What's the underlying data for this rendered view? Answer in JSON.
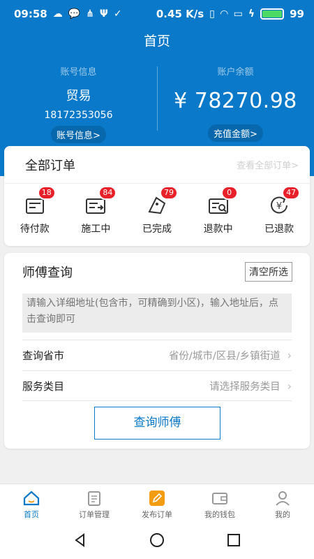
{
  "status_bar": {
    "time": "09:58",
    "speed": "0.45 K/s",
    "battery": "99",
    "battery_level": 0.99
  },
  "header": {
    "title": "首页"
  },
  "account": {
    "info_heading": "账号信息",
    "name": "贸易",
    "phone": "18172353056",
    "info_button": "账号信息>",
    "balance_heading": "账户余额",
    "balance": "¥ 78270.98",
    "recharge_button": "充值金额>"
  },
  "orders": {
    "title": "全部订单",
    "view_all": "查看全部订单>",
    "items": [
      {
        "label": "待付款",
        "count": "18",
        "icon": "pending-payment-icon"
      },
      {
        "label": "施工中",
        "count": "84",
        "icon": "in-construction-icon"
      },
      {
        "label": "已完成",
        "count": "79",
        "icon": "completed-icon"
      },
      {
        "label": "退款中",
        "count": "0",
        "icon": "refunding-icon"
      },
      {
        "label": "已退款",
        "count": "47",
        "icon": "refunded-icon"
      }
    ]
  },
  "master_search": {
    "title": "师傅查询",
    "clear_button": "清空所选",
    "address_placeholder": "请输入详细地址(包含市，可精确到小区)，输入地址后，点击查询即可",
    "region_label": "查询省市",
    "region_placeholder": "省份/城市/区县/乡镇街道",
    "category_label": "服务类目",
    "category_placeholder": "请选择服务类目",
    "query_button": "查询师傅"
  },
  "tabs": [
    {
      "label": "首页",
      "active": true
    },
    {
      "label": "订单管理",
      "active": false
    },
    {
      "label": "发布订单",
      "active": false
    },
    {
      "label": "我的钱包",
      "active": false
    },
    {
      "label": "我的",
      "active": false
    }
  ],
  "colors": {
    "brand": "#0a79c9",
    "badge": "#e8202a",
    "publish": "#f39c12"
  }
}
